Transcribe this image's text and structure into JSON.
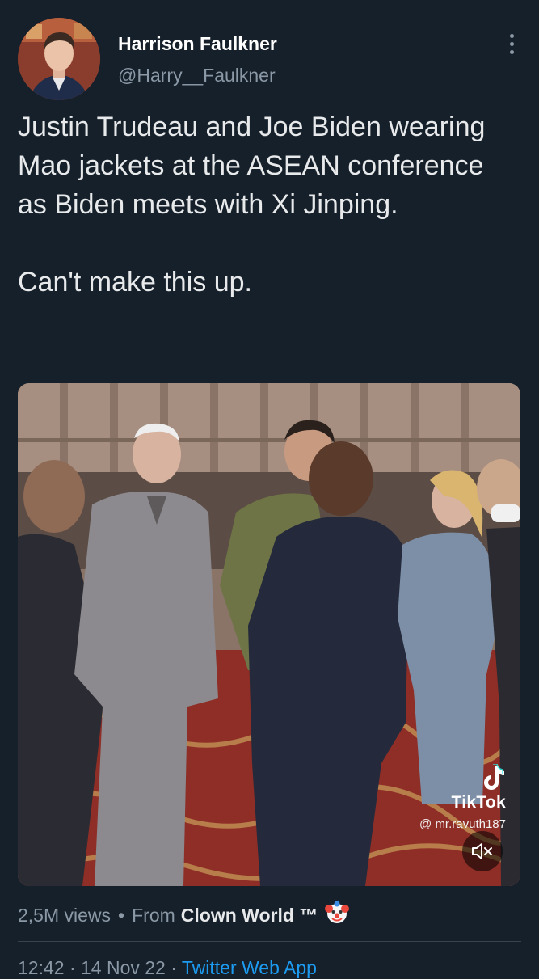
{
  "tweet": {
    "author_name": "Harrison Faulkner",
    "author_handle": "@Harry__Faulkner",
    "text": "Justin Trudeau and Joe Biden wearing Mao jackets at the ASEAN conference as Biden meets with Xi Jinping.\n\nCan't make this up.",
    "views": "2,5M views",
    "separator": "•",
    "source_prefix": "From",
    "source_name": "Clown World ™",
    "time": "12:42 · 14 Nov 22 ·",
    "client": "Twitter Web App"
  },
  "media": {
    "watermark_name": "TikTok",
    "watermark_handle": "@ mr.ravuth187"
  },
  "icons": {
    "more": "more-vertical-icon",
    "mute": "speaker-muted-icon",
    "clown": "clown-face-emoji"
  },
  "colors": {
    "background": "#15202b",
    "secondary_text": "#8b98a5",
    "link": "#1d9bf0"
  }
}
